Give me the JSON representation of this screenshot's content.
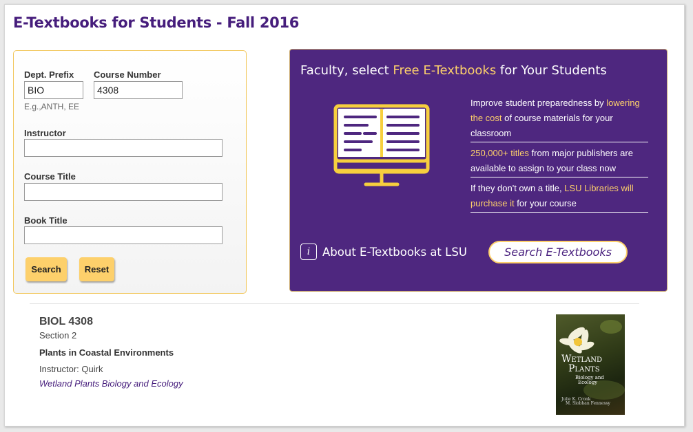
{
  "page": {
    "title": "E-Textbooks for Students - Fall 2016"
  },
  "search": {
    "dept_label": "Dept. Prefix",
    "dept_value": "BIO",
    "dept_hint": "E.g.,ANTH, EE",
    "course_label": "Course Number",
    "course_value": "4308",
    "instructor_label": "Instructor",
    "instructor_value": "",
    "course_title_label": "Course Title",
    "course_title_value": "",
    "book_title_label": "Book Title",
    "book_title_value": "",
    "search_button": "Search",
    "reset_button": "Reset"
  },
  "promo": {
    "heading_pre": "Faculty, select ",
    "heading_highlight": "Free E-Textbooks",
    "heading_post": " for Your Students",
    "benefits": [
      {
        "pre": "Improve student preparedness by ",
        "highlight": "lowering the cost",
        "post": " of course materials for your classroom"
      },
      {
        "pre": "",
        "highlight": "250,000+ titles",
        "post": " from major publishers are available to assign to your class now"
      },
      {
        "pre": "If they don't own a title, ",
        "highlight": "LSU Libraries will purchase it",
        "post": " for your course"
      }
    ],
    "about_label": "About E-Textbooks at LSU",
    "search_button": "Search E-Textbooks",
    "icons": [
      "book-monitor-icon",
      "info-icon"
    ]
  },
  "result": {
    "course_code": "BIOL 4308",
    "section": "Section 2",
    "course_title": "Plants in Coastal Environments",
    "instructor": "Instructor: Quirk",
    "book_title": "Wetland Plants Biology and Ecology",
    "cover": {
      "title_line1": "Wetland",
      "title_line2": "Plants",
      "subtitle_line1": "Biology and",
      "subtitle_line2": "Ecology",
      "authors_line1": "Julie K. Cronk",
      "authors_line2": "M. Siobhan Fennessy"
    }
  },
  "colors": {
    "brand_purple": "#461d7c",
    "gold": "#fdd06b",
    "promo_bg": "#4e277f"
  }
}
